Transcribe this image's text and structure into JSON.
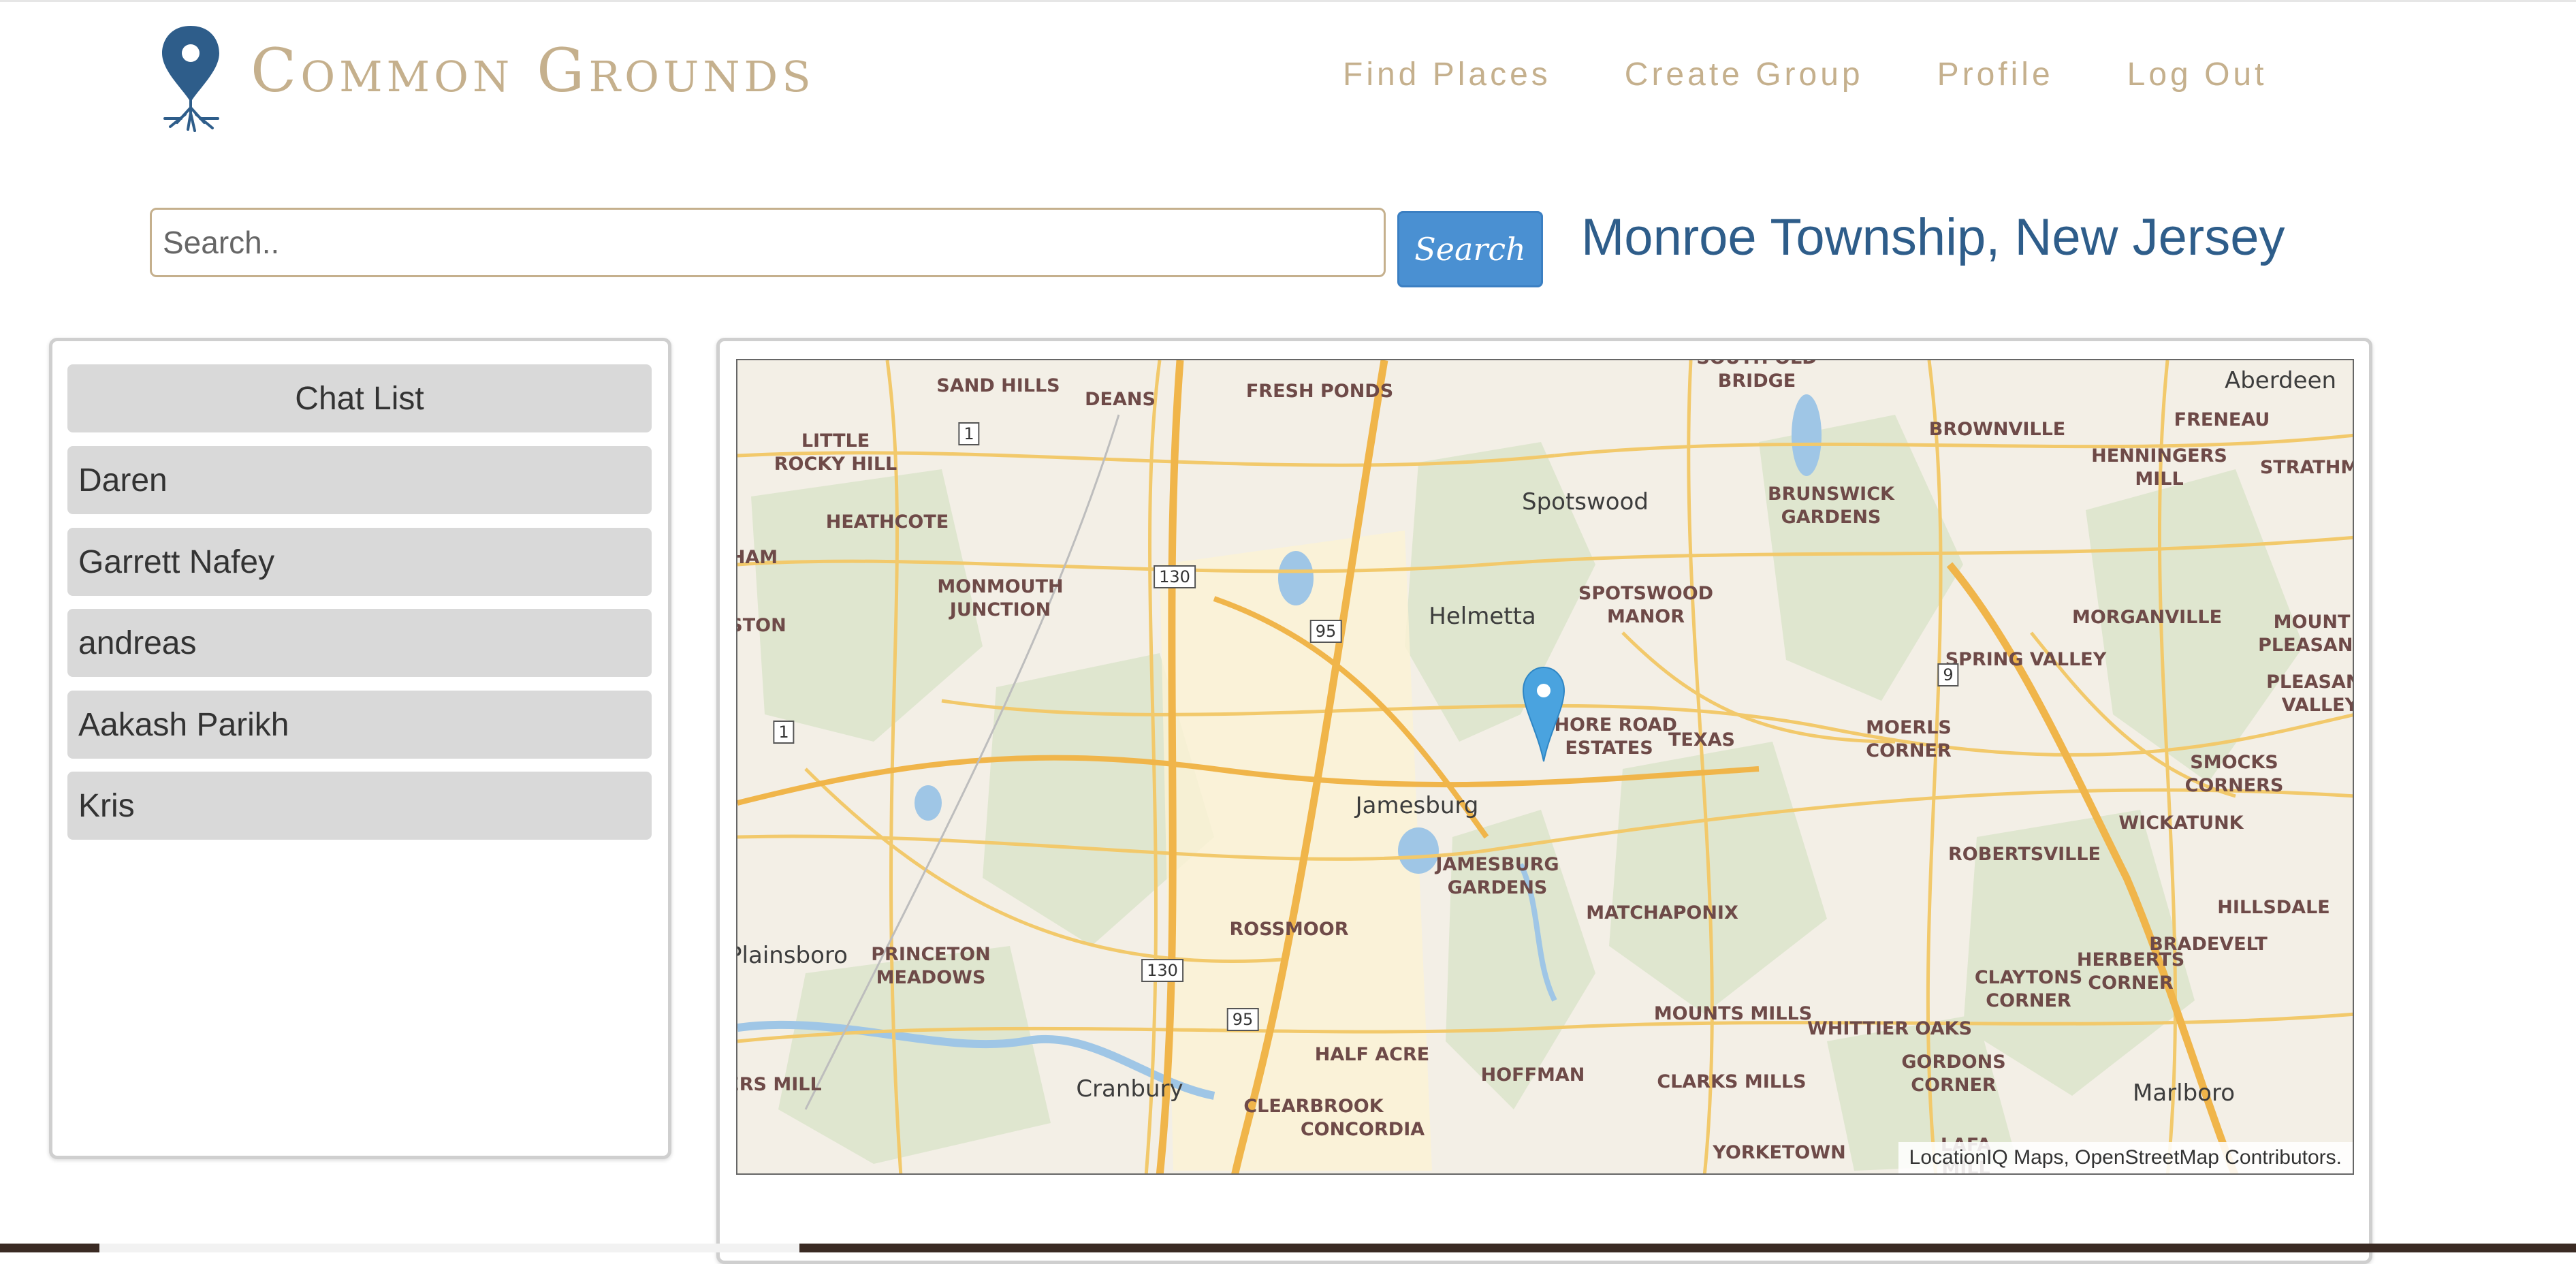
{
  "brand": {
    "name": "Common Grounds",
    "logo_icon": "pin-roots-icon",
    "color": "#c5b08d",
    "logo_color": "#2e5d8a"
  },
  "nav": {
    "items": [
      {
        "label": "Find Places"
      },
      {
        "label": "Create Group"
      },
      {
        "label": "Profile"
      },
      {
        "label": "Log Out"
      }
    ]
  },
  "search": {
    "placeholder": "Search..",
    "value": "",
    "button_label": "Search",
    "button_color": "#4a90d2"
  },
  "location": {
    "title": "Monroe Township, New Jersey",
    "color": "#2e5d8a"
  },
  "chat_list": {
    "header": "Chat List",
    "items": [
      "Daren",
      "Garrett Nafey",
      "andreas",
      "Aakash Parikh",
      "Kris"
    ]
  },
  "map": {
    "attribution": "LocationIQ Maps, OpenStreetMap Contributors.",
    "marker_icon": "map-marker-icon",
    "marker_color": "#4aa3df",
    "labels": {
      "sand_hills": "SAND HILLS",
      "deans": "DEANS",
      "fresh_ponds": "FRESH PONDS",
      "south_old_bridge": "SOUTH OLD\nBRIDGE",
      "aberdeen": "Aberdeen",
      "brownville": "BROWNVILLE",
      "freneau": "FRENEAU",
      "henningers_mill": "HENNINGERS\nMILL",
      "strathmore": "STRATHMO",
      "little_rocky_hill": "LITTLE\nROCKY HILL",
      "spotswood": "Spotswood",
      "brunswick_gardens": "BRUNSWICK\nGARDENS",
      "heathcote": "HEATHCOTE",
      "ham": "HAM",
      "monmouth_junction": "MONMOUTH\nJUNCTION",
      "spotswood_manor": "SPOTSWOOD\nMANOR",
      "helmetta": "Helmetta",
      "morganville": "MORGANVILLE",
      "mount_pleasant": "MOUNT\nPLEASANT",
      "ston": "STON",
      "spring_valley": "SPRING VALLEY",
      "pleasant_valley": "PLEASANT\nVALLEY",
      "shore_road_estates": "SHORE ROAD\nESTATES",
      "texas": "TEXAS",
      "moerls_corner": "MOERLS\nCORNER",
      "smocks_corners": "SMOCKS\nCORNERS",
      "jamesburg": "Jamesburg",
      "wickatunk": "WICKATUNK",
      "robertsville": "ROBERTSVILLE",
      "jamesburg_gardens": "JAMESBURG\nGARDENS",
      "matchaponix": "MATCHAPONIX",
      "hillsdale": "HILLSDALE",
      "bradevelt": "BRADEVELT",
      "rossmoor": "ROSSMOOR",
      "plainsboro": "Plainsboro",
      "princeton_meadows": "PRINCETON\nMEADOWS",
      "claytons_corner": "CLAYTONS\nCORNER",
      "herberts_corner": "HERBERTS\nCORNER",
      "mounts_mills": "MOUNTS MILLS",
      "whittier_oaks": "WHITTIER OAKS",
      "half_acre": "HALF ACRE",
      "gordons_corner": "GORDONS\nCORNER",
      "ers_mill": "ERS MILL",
      "cranbury": "Cranbury",
      "hoffman": "HOFFMAN",
      "clarks_mills": "CLARKS MILLS",
      "marlboro": "Marlboro",
      "clearbrook": "CLEARBROOK",
      "concordia": "CONCORDIA",
      "yorketown": "YORKETOWN",
      "lafa_mill": "LAFA\nMILL"
    },
    "shields": {
      "route_1_north": "1",
      "route_130_north": "130",
      "route_95_north": "95",
      "route_9": "9",
      "route_1_south": "1",
      "route_130_south": "130",
      "route_95_south": "95"
    }
  }
}
